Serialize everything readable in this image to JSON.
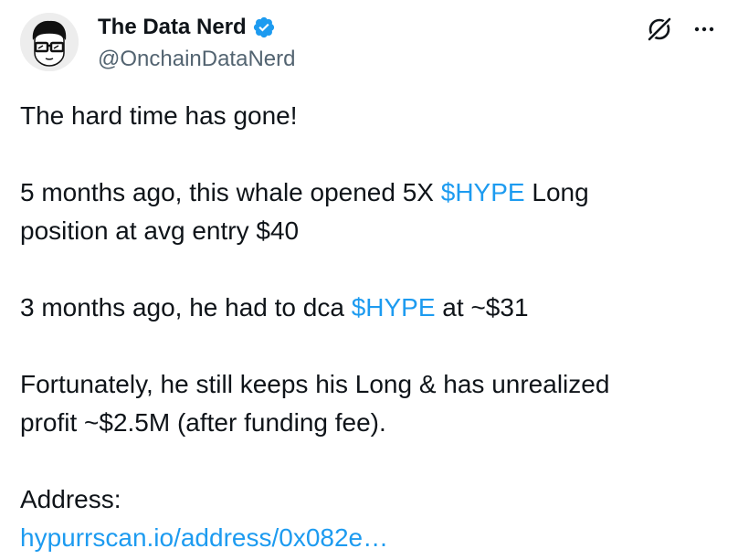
{
  "author": {
    "display_name": "The Data Nerd",
    "handle": "@OnchainDataNerd",
    "verified": true
  },
  "icons": {
    "verified": "verified-badge-icon",
    "grok": "grok-icon",
    "more": "more-options-icon"
  },
  "colors": {
    "link": "#1d9bf0",
    "text": "#0f1419",
    "secondary": "#536471",
    "verified": "#1d9bf0"
  },
  "post": {
    "line1": "The hard time has gone!",
    "p2_a": "5 months ago, this whale opened 5X ",
    "p2_cashtag": "$HYPE",
    "p2_b": " Long",
    "p2_line2": "position at avg entry $40",
    "p3_a": "3 months ago, he had to dca ",
    "p3_cashtag": "$HYPE",
    "p3_b": " at ~$31",
    "p4_line1": "Fortunately, he still keeps his Long & has unrealized",
    "p4_line2": "profit ~$2.5M (after funding fee).",
    "p5_label": "Address:",
    "p5_link": "hypurrscan.io/address/0x082e…"
  }
}
